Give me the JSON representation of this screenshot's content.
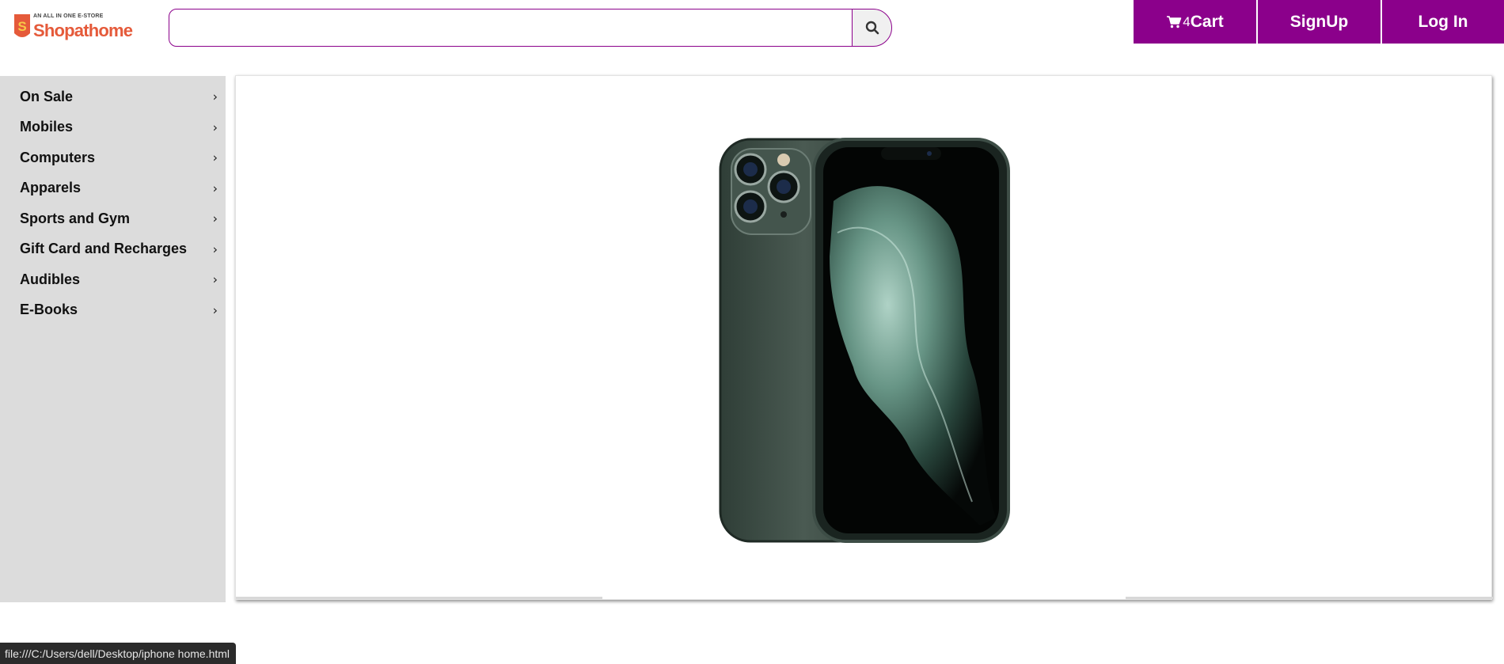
{
  "header": {
    "logo": {
      "tagline": "AN ALL IN ONE E-STORE",
      "name": "Shopathome",
      "badge_letter": "S"
    },
    "search": {
      "value": "",
      "placeholder": "",
      "button_icon": "search-icon"
    },
    "nav": {
      "cart_icon": "cart-icon",
      "cart_count": "4",
      "cart_label": "Cart",
      "signup_label": "SignUp",
      "login_label": "Log In"
    }
  },
  "sidebar": {
    "items": [
      {
        "label": "On Sale"
      },
      {
        "label": "Mobiles"
      },
      {
        "label": "Computers"
      },
      {
        "label": "Apparels"
      },
      {
        "label": "Sports and Gym"
      },
      {
        "label": "Gift Card and Recharges"
      },
      {
        "label": "Audibles"
      },
      {
        "label": "E-Books"
      }
    ],
    "chevron": "›"
  },
  "banner": {
    "image": "iphone-product-image"
  },
  "statusbar": {
    "url": "file:///C:/Users/dell/Desktop/iphone home.html"
  },
  "colors": {
    "accent": "#8b008b",
    "logo": "#e55a3a",
    "sidebar_bg": "#dcdcdc"
  }
}
